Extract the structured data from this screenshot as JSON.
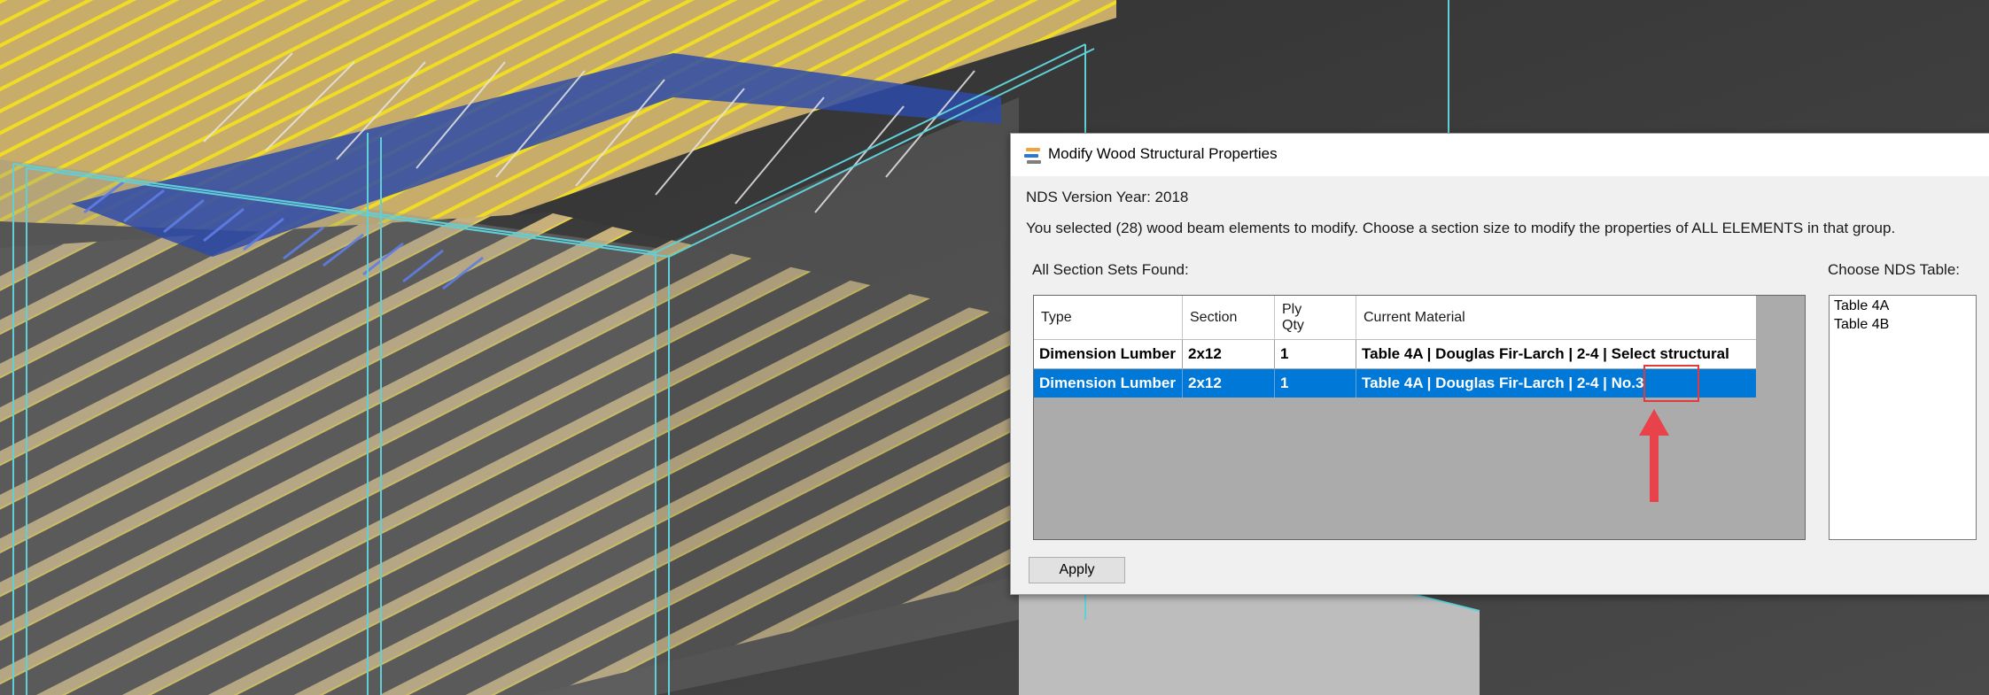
{
  "dialog": {
    "title": "Modify Wood Structural Properties",
    "app_icon": "stacked-bars-logo-icon",
    "nds_version": "NDS Version Year: 2018",
    "instructions": "You selected (28) wood beam elements to modify. Choose a section size to modify the properties of ALL ELEMENTS in that group.",
    "section_sets_label": "All Section Sets Found:",
    "nds_table_label": "Choose NDS Table:",
    "apply_label": "Apply"
  },
  "grid": {
    "headers": {
      "type": "Type",
      "section": "Section",
      "ply_line1": "Ply",
      "ply_line2": "Qty",
      "material": "Current Material"
    },
    "rows": [
      {
        "type": "Dimension Lumber",
        "section": "2x12",
        "ply": "1",
        "material": "Table 4A | Douglas Fir-Larch | 2-4 | Select structural",
        "selected": false
      },
      {
        "type": "Dimension Lumber",
        "section": "2x12",
        "ply": "1",
        "material": "Table 4A | Douglas Fir-Larch | 2-4 | No.3",
        "selected": true
      }
    ]
  },
  "nds_tables": [
    "Table 4A",
    "Table 4B"
  ],
  "annotation": {
    "highlight_color": "#e23a3a",
    "arrow_color": "#e8424a",
    "arrow_icon": "red-up-arrow-icon"
  },
  "colors": {
    "selection": "#0078d7",
    "dialog_bg": "#f0f0f0",
    "wood": "#c9b27a",
    "beam_blue": "#3a5ccc",
    "edge_cyan": "#5fd0d8"
  }
}
